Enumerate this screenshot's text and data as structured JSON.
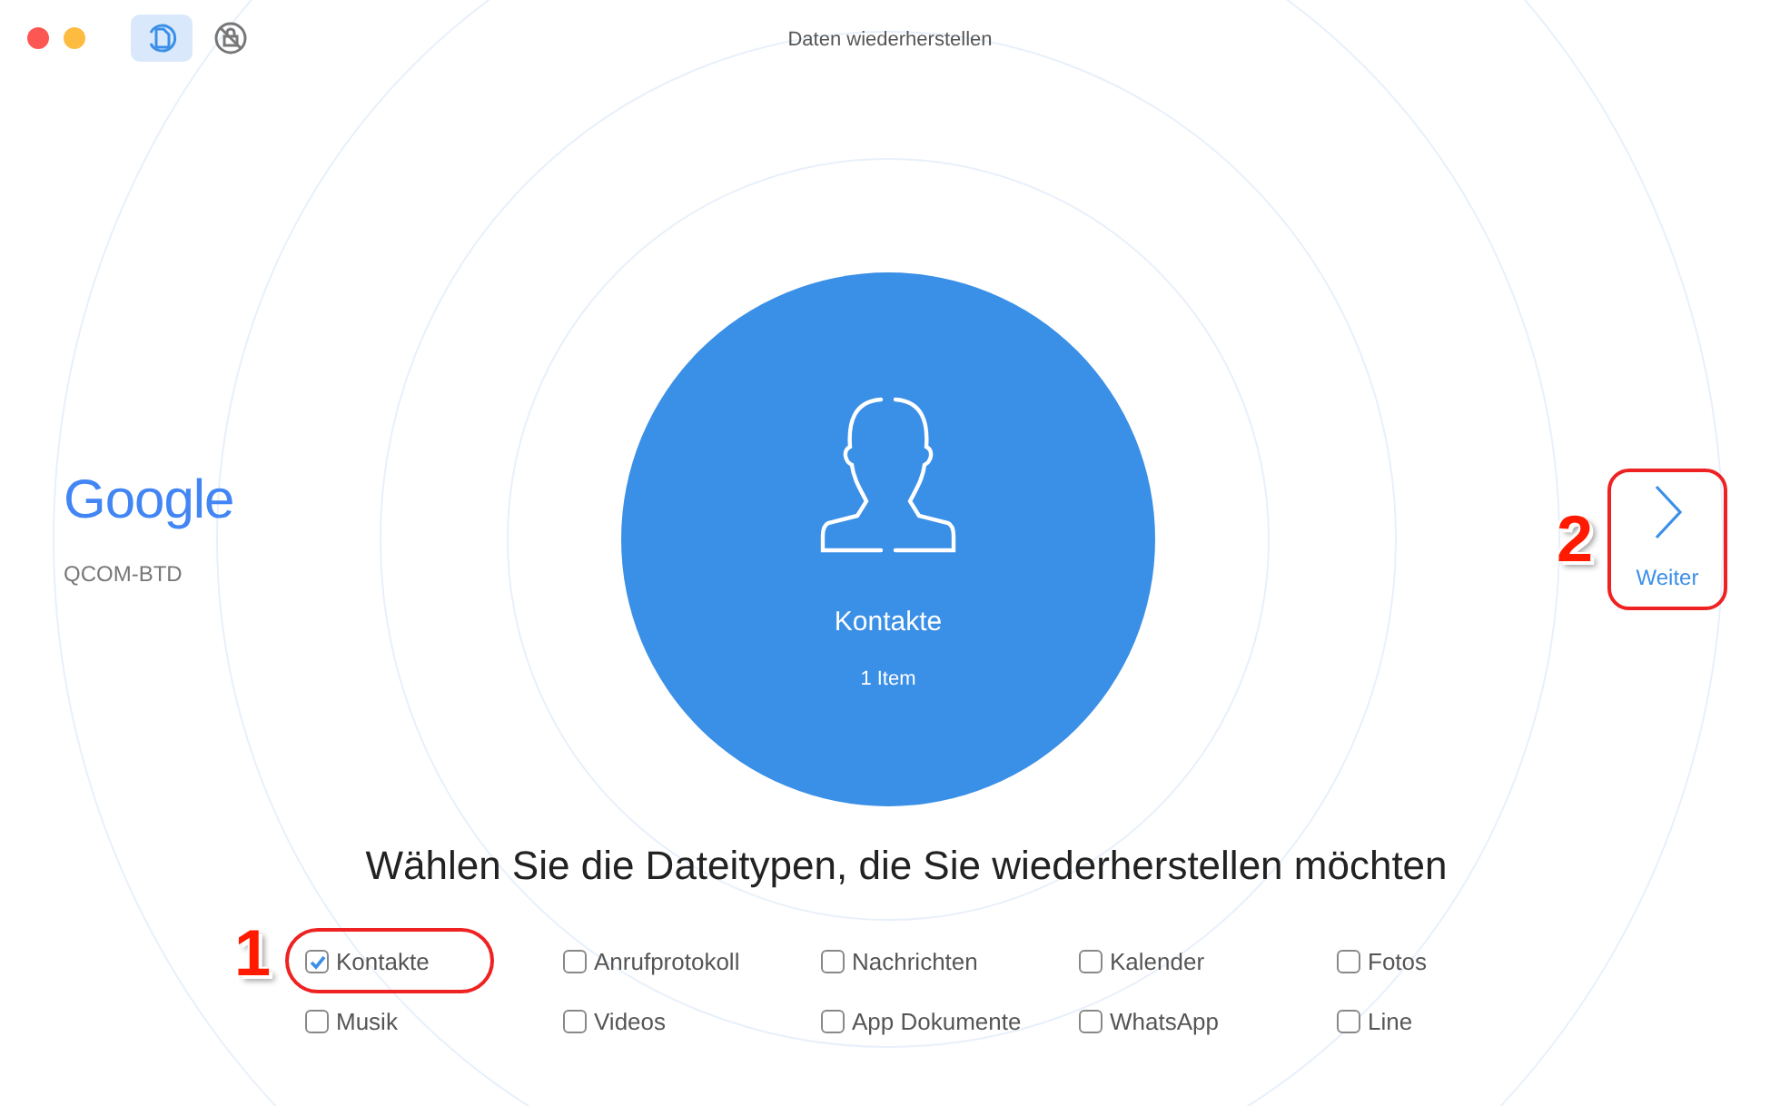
{
  "window": {
    "title": "Daten wiederherstellen"
  },
  "toolbar": [
    {
      "kind": "restore",
      "selected": true
    },
    {
      "kind": "lock",
      "selected": false
    }
  ],
  "device": {
    "brand": "Google",
    "model": "QCOM-BTD"
  },
  "category": {
    "title": "Kontakte",
    "count": "1 Item"
  },
  "heading": "Wählen Sie die Dateitypen, die Sie wiederherstellen möchten",
  "file_types": [
    {
      "label": "Kontakte",
      "checked": true
    },
    {
      "label": "Anrufprotokoll",
      "checked": false
    },
    {
      "label": "Nachrichten",
      "checked": false
    },
    {
      "label": "Kalender",
      "checked": false
    },
    {
      "label": "Fotos",
      "checked": false
    },
    {
      "label": "Musik",
      "checked": false
    },
    {
      "label": "Videos",
      "checked": false
    },
    {
      "label": "App Dokumente",
      "checked": false
    },
    {
      "label": "WhatsApp",
      "checked": false
    },
    {
      "label": "Line",
      "checked": false
    }
  ],
  "next_button": {
    "label": "Weiter"
  },
  "annotations": [
    {
      "number": "1"
    },
    {
      "number": "2"
    }
  ]
}
